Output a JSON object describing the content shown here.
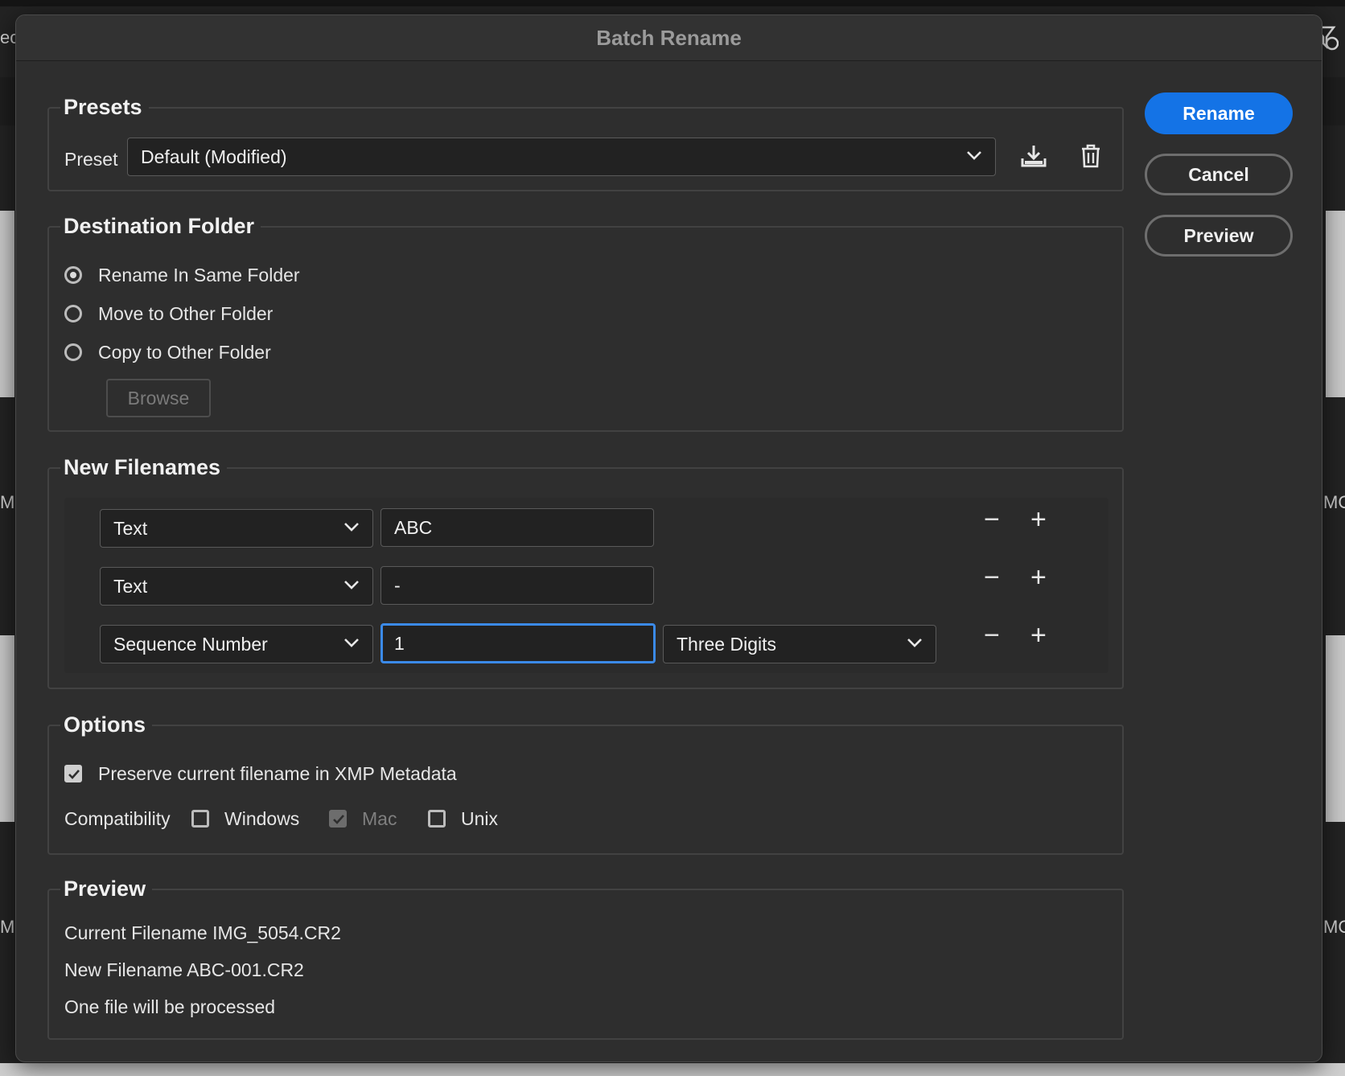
{
  "background": {
    "edge_labels": [
      "ec",
      "MG",
      "MG",
      "MG",
      "MG"
    ]
  },
  "dialog": {
    "title": "Batch Rename"
  },
  "actions": {
    "rename": "Rename",
    "cancel": "Cancel",
    "preview": "Preview"
  },
  "presets": {
    "legend": "Presets",
    "preset_label": "Preset",
    "preset_value": "Default (Modified)",
    "save_icon": "download-icon",
    "delete_icon": "trash-icon"
  },
  "destination": {
    "legend": "Destination Folder",
    "options": [
      {
        "label": "Rename In Same Folder",
        "selected": true
      },
      {
        "label": "Move to Other Folder",
        "selected": false
      },
      {
        "label": "Copy to Other Folder",
        "selected": false
      }
    ],
    "browse": "Browse"
  },
  "new_filenames": {
    "legend": "New Filenames",
    "rows": [
      {
        "type": "Text",
        "value": "ABC"
      },
      {
        "type": "Text",
        "value": "-"
      },
      {
        "type": "Sequence Number",
        "value": "1",
        "format": "Three Digits"
      }
    ],
    "remove_symbol": "−",
    "add_symbol": "+"
  },
  "options": {
    "legend": "Options",
    "preserve_label": "Preserve current filename in XMP Metadata",
    "preserve_checked": true,
    "compatibility_label": "Compatibility",
    "windows": {
      "label": "Windows",
      "checked": false
    },
    "mac": {
      "label": "Mac",
      "checked": true,
      "disabled": true
    },
    "unix": {
      "label": "Unix",
      "checked": false
    }
  },
  "preview": {
    "legend": "Preview",
    "current": "Current Filename IMG_5054.CR2",
    "new": "New Filename ABC-001.CR2",
    "count": "One file will be processed"
  },
  "colors": {
    "accent": "#1473e6",
    "focus": "#3b8ae8",
    "dialog_bg": "#2e2e2e"
  }
}
